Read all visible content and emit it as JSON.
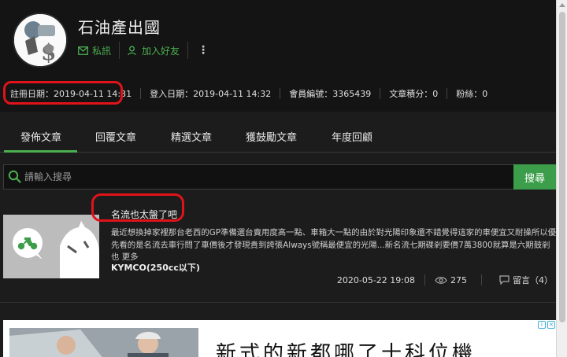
{
  "profile": {
    "name": "石油產出國",
    "message_label": "私訊",
    "add_friend_label": "加入好友",
    "more_label": "⋮"
  },
  "stats": {
    "register": "註冊日期：2019-04-11 14:31",
    "login": "登入日期：2019-04-11 14:32",
    "member_id": "會員編號：3365439",
    "points": "文章積分：0",
    "fans": "粉絲：0"
  },
  "tabs": [
    {
      "label": "發佈文章",
      "active": true
    },
    {
      "label": "回覆文章",
      "active": false
    },
    {
      "label": "精選文章",
      "active": false
    },
    {
      "label": "獲鼓勵文章",
      "active": false
    },
    {
      "label": "年度回顧",
      "active": false
    }
  ],
  "search": {
    "placeholder": "請輸入搜尋",
    "button_label": "搜尋"
  },
  "post": {
    "title": "名流也太盤了吧",
    "excerpt": "最近想換掉家裡那台老西的GP準備選台賣用度高一點、車箱大一點的由於對光陽印象還不錯覺得這家的車便宜又耐操所以優先看的是名流去車行問了車價後才發現貴到誇張Always號稱最便宜的光陽...新名流七期碟剎要價7萬3800就算是六期鼓剎也 更多",
    "tag": "KYMCO(250cc以下)",
    "date": "2020-05-22 19:08",
    "views": "275",
    "comments_label": "留言（4）"
  },
  "ad": {
    "headline": "新式的新都哪了十科位機"
  },
  "colors": {
    "accent": "#4caf50",
    "highlight": "#e0131a",
    "background": "#1c1c1c"
  }
}
